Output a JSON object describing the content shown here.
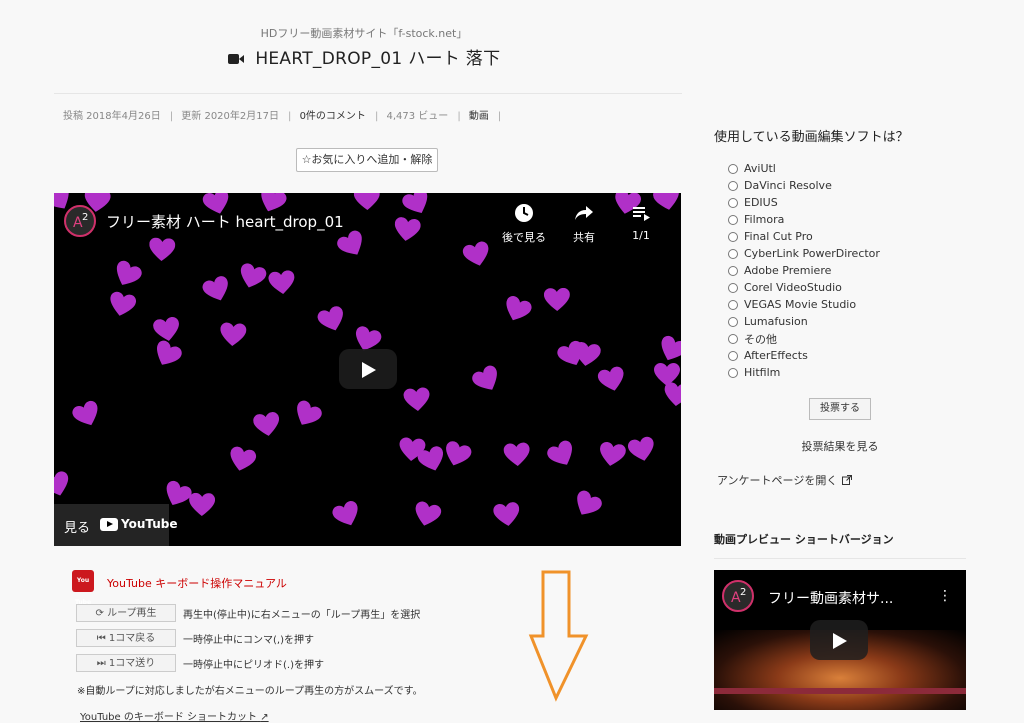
{
  "header": {
    "tagline": "HDフリー動画素材サイト「f-stock.net」",
    "title": "HEART_DROP_01 ハート 落下"
  },
  "meta": {
    "posted": "投稿 2018年4月26日",
    "updated": "更新 2020年2月17日",
    "comments": "0件のコメント",
    "views": "4,473 ビュー",
    "category": "動画"
  },
  "favorite_button": "☆お気に入りへ追加・解除",
  "player": {
    "title": "フリー素材 ハート heart_drop_01",
    "watch_later": "後で見る",
    "share": "共有",
    "playlist_count": "1/1",
    "watch_on": "見る",
    "youtube": "YouTube",
    "heart_color": "#b030c8"
  },
  "manual": {
    "icon_text": "You Tube",
    "title": "YouTube キーボード操作マニュアル",
    "rows": [
      {
        "key": "⟳ ループ再生",
        "desc": "再生中(停止中)に右メニューの「ループ再生」を選択"
      },
      {
        "key": "⏮ 1コマ戻る",
        "desc": "一時停止中にコンマ(,)を押す"
      },
      {
        "key": "⏭ 1コマ送り",
        "desc": "一時停止中にピリオド(.)を押す"
      }
    ],
    "note": "※自動ループに対応しましたが右メニューのループ再生の方がスムーズです。",
    "shortcut_link": "YouTube のキーボード ショートカット"
  },
  "poll": {
    "title": "使用している動画編集ソフトは？",
    "options": [
      "AviUtl",
      "DaVinci Resolve",
      "EDIUS",
      "Filmora",
      "Final Cut Pro",
      "CyberLink PowerDirector",
      "Adobe Premiere",
      "Corel VideoStudio",
      "VEGAS Movie Studio",
      "Lumafusion",
      "その他",
      "AfterEffects",
      "Hitfilm"
    ],
    "vote_button": "投票する",
    "results_link": "投票結果を見る",
    "survey_link": "アンケートページを開く"
  },
  "preview": {
    "heading": "動画プレビュー ショートバージョン",
    "video_title": "フリー動画素材サ..."
  },
  "colors": {
    "arrow": "#f0922a",
    "link_red": "#cc0000"
  }
}
